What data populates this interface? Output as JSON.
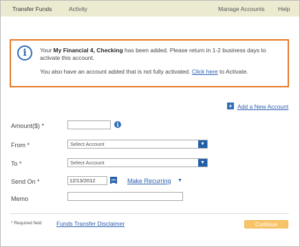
{
  "nav": {
    "transfer_funds": "Transfer Funds",
    "activity": "Activity",
    "manage_accounts": "Manage Accounts",
    "help": "Help"
  },
  "alert": {
    "prefix": "Your ",
    "account_name": "My Financial 4, Checking",
    "suffix": " has been added. Please return in 1-2 business days to activate this account.",
    "line2_prefix": "You also have an account added that is not fully activated. ",
    "line2_link": "Click here",
    "line2_suffix": " to Activate."
  },
  "add_account": {
    "label": "Add a New Account"
  },
  "form": {
    "amount_label": "Amount($) *",
    "amount_value": "",
    "from_label": "From *",
    "from_value": "Select Account",
    "to_label": "To *",
    "to_value": "Select Account",
    "send_on_label": "Send On *",
    "send_on_value": "12/13/2012",
    "make_recurring": "Make Recurring",
    "memo_label": "Memo",
    "memo_value": ""
  },
  "footer": {
    "required": "* Required field",
    "disclaimer": "Funds Transfer Disclaimer",
    "continue": "Continue"
  },
  "colors": {
    "nav_bg": "#ecebd2",
    "alert_border": "#e87722",
    "link": "#2a5db0",
    "icon_blue": "#2f6db5",
    "continue_bg": "#f8c46a"
  }
}
